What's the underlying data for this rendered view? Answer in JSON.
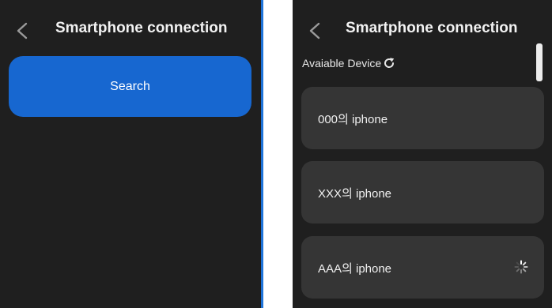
{
  "left_screen": {
    "title": "Smartphone connection",
    "search_label": "Search"
  },
  "right_screen": {
    "title": "Smartphone connection",
    "available_label": "Avaiable Device",
    "devices": [
      {
        "label": "000의 iphone",
        "loading": false
      },
      {
        "label": "XXX의 iphone",
        "loading": false
      },
      {
        "label": "AAA의 iphone",
        "loading": true
      }
    ]
  },
  "colors": {
    "background": "#1f1f1f",
    "accent": "#1767d0",
    "card": "#353535",
    "divider": "#1e73d8"
  },
  "icons": [
    "chevron-left-icon",
    "refresh-icon",
    "loading-spinner-icon"
  ]
}
